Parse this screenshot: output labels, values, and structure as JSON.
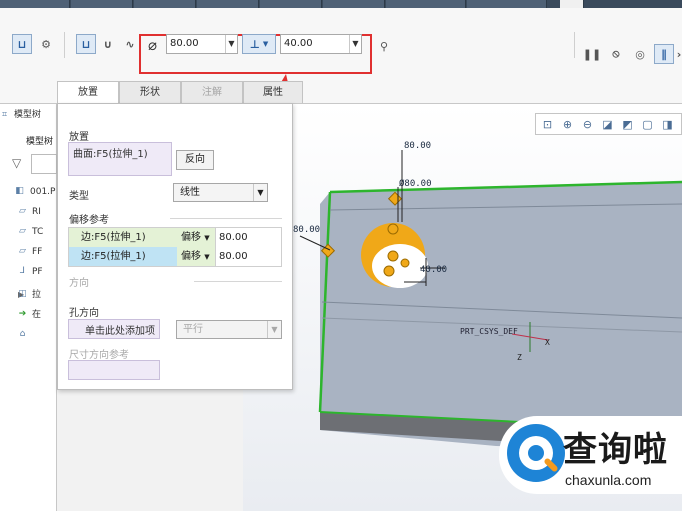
{
  "toolbar": {
    "diameter_value": "80.00",
    "depth_value": "40.00"
  },
  "panel": {
    "tabs": [
      {
        "label": "放置"
      },
      {
        "label": "形状"
      },
      {
        "label": "注解"
      },
      {
        "label": "属性"
      }
    ],
    "placement_label": "放置",
    "placement_value": "曲面:F5(拉伸_1)",
    "flip_button": "反向",
    "type_label": "类型",
    "type_value": "线性",
    "offset_refs_label": "偏移参考",
    "refs": [
      {
        "ref": "边:F5(拉伸_1)",
        "mode": "偏移",
        "value": "80.00"
      },
      {
        "ref": "边:F5(拉伸_1)",
        "mode": "偏移",
        "value": "80.00"
      }
    ],
    "direction_label": "方向",
    "hole_direction_label": "孔方向",
    "add_item_button": "单击此处添加项",
    "parallel_value": "平行",
    "dim_ref_label": "尺寸方向参考"
  },
  "tree": {
    "header": "模型树",
    "subheader": "模型树",
    "items": [
      {
        "label": "001.P"
      },
      {
        "label": "RI"
      },
      {
        "label": "TC"
      },
      {
        "label": "FF"
      },
      {
        "label": "PF"
      },
      {
        "label": "拉"
      },
      {
        "label": "在"
      },
      {
        "label": ""
      }
    ]
  },
  "viewport": {
    "dim_top": "80.00",
    "dim_dia": "Ø80.00",
    "dim_left": "80.00",
    "dim_depth": "40.00",
    "csys_label": "PRT_CSYS_DEF",
    "axis_x": "X",
    "axis_z": "Z"
  },
  "watermark": {
    "title": "查询啦",
    "url": "chaxunla.com"
  },
  "colors": {
    "highlight_box": "#e03030",
    "arrow": "#e03030",
    "part_surface": "#a9b3c2",
    "part_edge": "#2db52d",
    "hole": "#f0a818"
  }
}
